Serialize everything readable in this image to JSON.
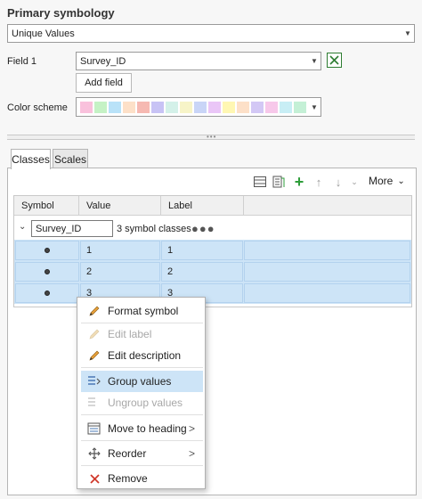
{
  "panel": {
    "title": "Primary symbology",
    "renderer": "Unique Values",
    "field1_label": "Field 1",
    "field1_value": "Survey_ID",
    "add_field_label": "Add field",
    "color_scheme_label": "Color scheme",
    "color_swatches": [
      "#f9c1dc",
      "#c5f2c5",
      "#b9e2f8",
      "#fde0c8",
      "#f6b9b2",
      "#c8c3f5",
      "#d4f1e9",
      "#f7f4c8",
      "#c9d5f7",
      "#eac6f7",
      "#fff7b3",
      "#fde0c8",
      "#d3c8f5",
      "#f7c8ea",
      "#c8eef5",
      "#c4f0d6"
    ]
  },
  "tabs": [
    {
      "label": "Classes",
      "active": true
    },
    {
      "label": "Scales",
      "active": false
    }
  ],
  "toolbar": {
    "icons": [
      "list-icon",
      "properties-icon",
      "add-icon",
      "move-up-icon",
      "move-down-icon",
      "collapse-icon"
    ],
    "more_label": "More"
  },
  "table": {
    "columns": [
      "Symbol",
      "Value",
      "Label"
    ],
    "group": {
      "heading": "Survey_ID",
      "count_text": "3 symbol classes"
    },
    "rows": [
      {
        "value": "1",
        "label": "1"
      },
      {
        "value": "2",
        "label": "2"
      },
      {
        "value": "3",
        "label": "3"
      }
    ]
  },
  "context_menu": {
    "items": [
      {
        "label": "Format symbol",
        "icon": "pencil-icon",
        "enabled": true,
        "hover": false,
        "submenu": false
      },
      {
        "label": "Edit label",
        "icon": "pencil-icon",
        "enabled": false,
        "hover": false,
        "submenu": false
      },
      {
        "label": "Edit description",
        "icon": "pencil-icon",
        "enabled": true,
        "hover": false,
        "submenu": false
      },
      {
        "label": "Group values",
        "icon": "group-values-icon",
        "enabled": true,
        "hover": true,
        "submenu": false
      },
      {
        "label": "Ungroup values",
        "icon": "ungroup-values-icon",
        "enabled": false,
        "hover": false,
        "submenu": false
      },
      {
        "label": "Move to heading",
        "icon": "move-to-heading-icon",
        "enabled": true,
        "hover": false,
        "submenu": true
      },
      {
        "label": "Reorder",
        "icon": "reorder-icon",
        "enabled": true,
        "hover": false,
        "submenu": true
      },
      {
        "label": "Remove",
        "icon": "remove-x-icon",
        "enabled": true,
        "hover": false,
        "submenu": false
      }
    ]
  },
  "colors": {
    "accent": "#cde4f7",
    "add_green": "#2e9d3a",
    "remove_red": "#d0392b",
    "pencil_orange": "#e8a03a"
  }
}
